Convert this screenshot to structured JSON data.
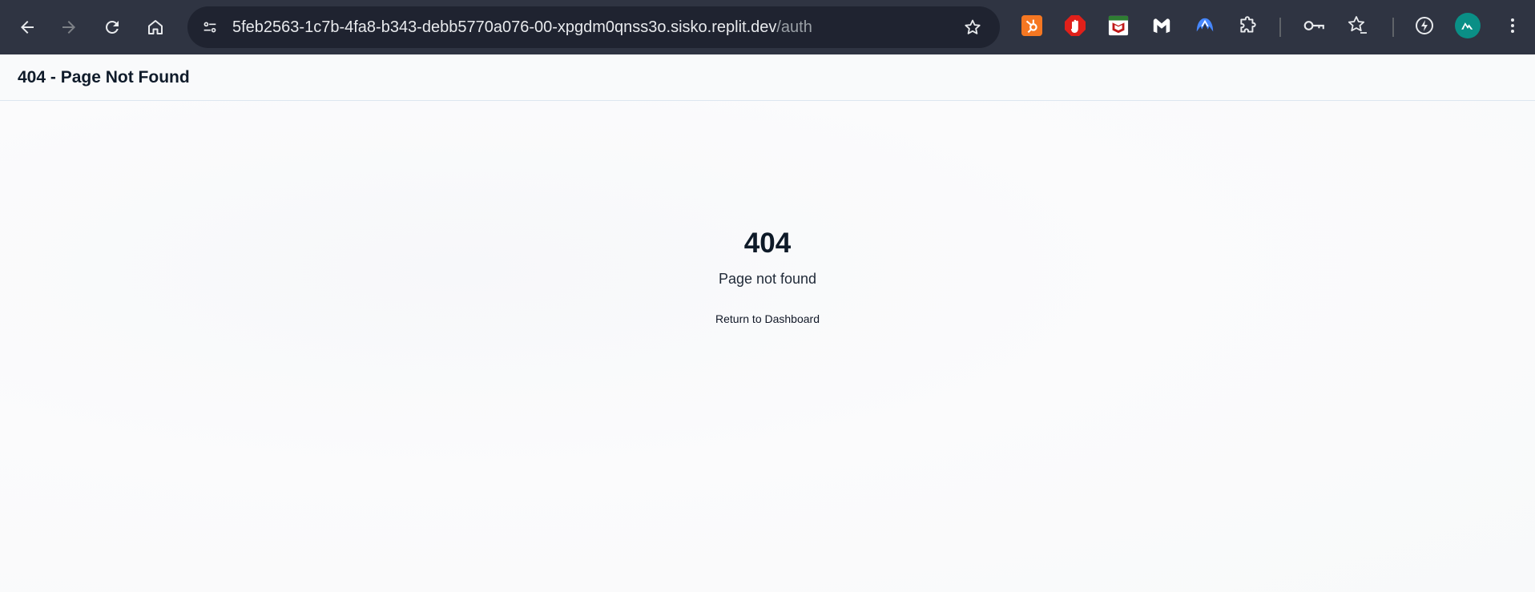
{
  "browser": {
    "url_host": "5feb2563-1c7b-4fa8-b343-debb5770a076-00-xpgdm0qnss3o.sisko.replit.dev",
    "url_path": "/auth",
    "nav": {
      "back_icon": "back-arrow-icon",
      "forward_icon": "forward-arrow-icon",
      "reload_icon": "reload-icon",
      "home_icon": "home-icon"
    },
    "extensions": [
      {
        "name": "hubspot-icon",
        "color": "#f57722"
      },
      {
        "name": "adblock-icon",
        "color": "#e0201a"
      },
      {
        "name": "mcafee-icon",
        "color": "#c01818"
      },
      {
        "name": "malwarebytes-icon",
        "color": "#ffffff"
      },
      {
        "name": "nordvpn-icon",
        "color": "#4687ff"
      },
      {
        "name": "extensions-puzzle-icon",
        "color": "#e8eaed"
      }
    ],
    "colors": {
      "toolbar": "#2f3442",
      "omnibox": "#1f2330",
      "profile_avatar": "#0a8f86"
    }
  },
  "page": {
    "header_title": "404 - Page Not Found",
    "error_code": "404",
    "error_message": "Page not found",
    "return_link": "Return to Dashboard"
  }
}
